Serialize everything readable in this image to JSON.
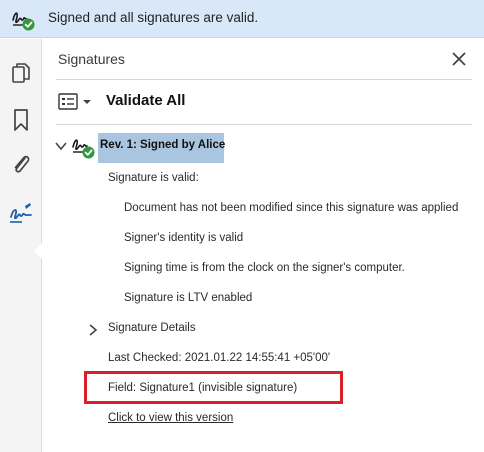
{
  "banner": {
    "text": "Signed and all signatures are valid.",
    "icon": "signature-valid-icon"
  },
  "rail": {
    "items": [
      {
        "name": "pages-icon"
      },
      {
        "name": "bookmark-icon"
      },
      {
        "name": "attachment-icon"
      },
      {
        "name": "signature-panel-icon",
        "active": true
      }
    ]
  },
  "panel": {
    "title": "Signatures",
    "close_icon": "close-icon",
    "validate_all_label": "Validate All",
    "revision": {
      "label": "Rev. 1: Signed by Alice",
      "status_text": "Signature is valid:",
      "details": [
        "Document has not been modified since this signature was applied",
        "Signer's identity is valid",
        "Signing time is from the clock on the signer's computer.",
        "Signature is LTV enabled"
      ],
      "signature_details_label": "Signature Details",
      "last_checked": "Last Checked: 2021.01.22 14:55:41 +05'00'",
      "field": "Field: Signature1 (invisible signature)",
      "view_version_link": "Click to view this version"
    }
  },
  "colors": {
    "banner_bg": "#d8e8f9",
    "selection_bg": "#a9c5df",
    "valid_green": "#2e9a3a",
    "highlight_red": "#d9202a",
    "icon_blue": "#1d5fa8"
  }
}
